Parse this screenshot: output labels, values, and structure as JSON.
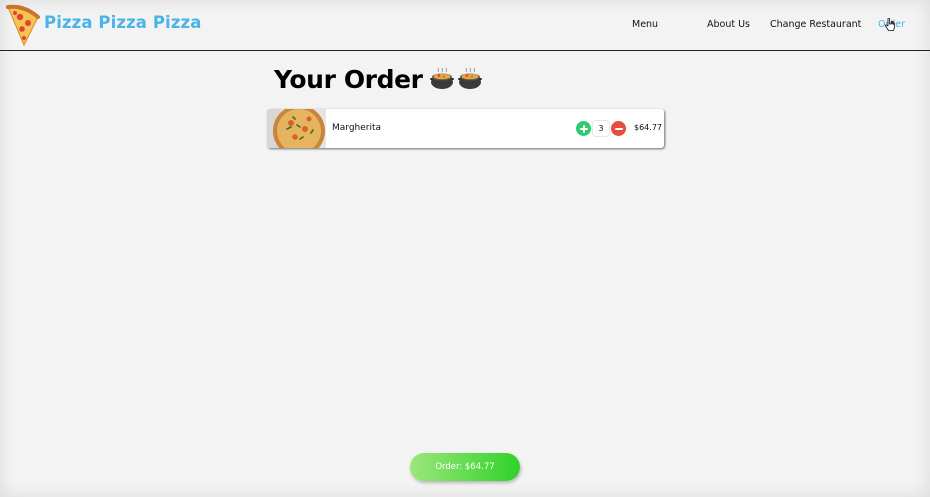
{
  "header": {
    "brand": "Pizza Pizza Pizza",
    "logo_icon": "pizza-slice-icon",
    "nav": {
      "menu": "Menu",
      "about": "About Us",
      "change_restaurant": "Change Restaurant",
      "order": "Order"
    },
    "active_nav_color": "#4bb4e6"
  },
  "main": {
    "title": "Your Order",
    "title_icons": [
      "pot-of-food-icon",
      "pot-of-food-icon"
    ],
    "items": [
      {
        "name": "Margherita",
        "quantity": "3",
        "price": "$64.77",
        "image": "pizza-photo"
      }
    ]
  },
  "footer": {
    "order_button": "Order: $64.77"
  },
  "colors": {
    "brand": "#4bb4e6",
    "plus": "#2ecc71",
    "minus": "#e74c3c",
    "order_gradient_start": "#9ce67a",
    "order_gradient_end": "#2fd22a"
  }
}
